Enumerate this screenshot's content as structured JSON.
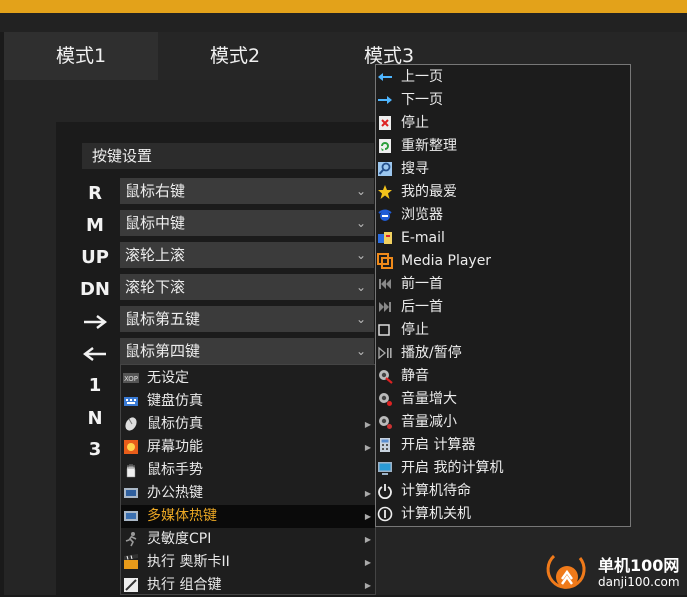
{
  "tabs": [
    "模式1",
    "模式2",
    "模式3"
  ],
  "section_title": "按键设置",
  "key_rows": [
    {
      "label": "R",
      "value": "鼠标右键"
    },
    {
      "label": "M",
      "value": "鼠标中键"
    },
    {
      "label": "UP",
      "value": "滚轮上滚"
    },
    {
      "label": "DN",
      "value": "滚轮下滚"
    },
    {
      "label": "",
      "value": "鼠标第五键",
      "arrow": "right"
    },
    {
      "label": "",
      "value": "鼠标第四键",
      "arrow": "left"
    }
  ],
  "extra_labels": [
    "1",
    "N",
    "3"
  ],
  "submenu": [
    {
      "label": "无设定",
      "icon": "xop-icon",
      "has_sub": false
    },
    {
      "label": "键盘仿真",
      "icon": "keyboard-icon",
      "has_sub": false
    },
    {
      "label": "鼠标仿真",
      "icon": "mouse-icon",
      "has_sub": true
    },
    {
      "label": "屏幕功能",
      "icon": "screen-icon",
      "has_sub": true
    },
    {
      "label": "鼠标手势",
      "icon": "hand-icon",
      "has_sub": false
    },
    {
      "label": "办公热键",
      "icon": "office-icon",
      "has_sub": true
    },
    {
      "label": "多媒体热键",
      "icon": "multimedia-icon",
      "has_sub": true,
      "highlighted": true
    },
    {
      "label": "灵敏度CPI",
      "icon": "runner-icon",
      "has_sub": true
    },
    {
      "label": "执行 奥斯卡II",
      "icon": "clapper-icon",
      "has_sub": true
    },
    {
      "label": "执行 组合键",
      "icon": "pen-icon",
      "has_sub": true
    }
  ],
  "popup": [
    {
      "label": "上一页",
      "icon": "back-arrow-icon"
    },
    {
      "label": "下一页",
      "icon": "forward-arrow-icon"
    },
    {
      "label": "停止",
      "icon": "stop-page-icon"
    },
    {
      "label": "重新整理",
      "icon": "refresh-icon"
    },
    {
      "label": "搜寻",
      "icon": "search-icon"
    },
    {
      "label": "我的最爱",
      "icon": "star-icon"
    },
    {
      "label": "浏览器",
      "icon": "browser-icon"
    },
    {
      "label": "E-mail",
      "icon": "email-icon"
    },
    {
      "label": "Media Player",
      "icon": "media-player-icon"
    },
    {
      "label": "前一首",
      "icon": "previous-track-icon"
    },
    {
      "label": "后一首",
      "icon": "next-track-icon"
    },
    {
      "label": "停止",
      "icon": "stop-square-icon"
    },
    {
      "label": "播放/暂停",
      "icon": "play-pause-icon"
    },
    {
      "label": "静音",
      "icon": "mute-icon"
    },
    {
      "label": "音量增大",
      "icon": "volume-up-icon"
    },
    {
      "label": "音量减小",
      "icon": "volume-down-icon"
    },
    {
      "label": "开启 计算器",
      "icon": "calculator-icon"
    },
    {
      "label": "开启 我的计算机",
      "icon": "computer-icon"
    },
    {
      "label": "计算机待命",
      "icon": "power-icon"
    },
    {
      "label": "计算机关机",
      "icon": "shutdown-icon"
    }
  ],
  "watermark": {
    "name": "单机100网",
    "url": "danji100.com"
  },
  "colors": {
    "accent": "#e3a21a",
    "highlight_text": "#e9a624"
  }
}
